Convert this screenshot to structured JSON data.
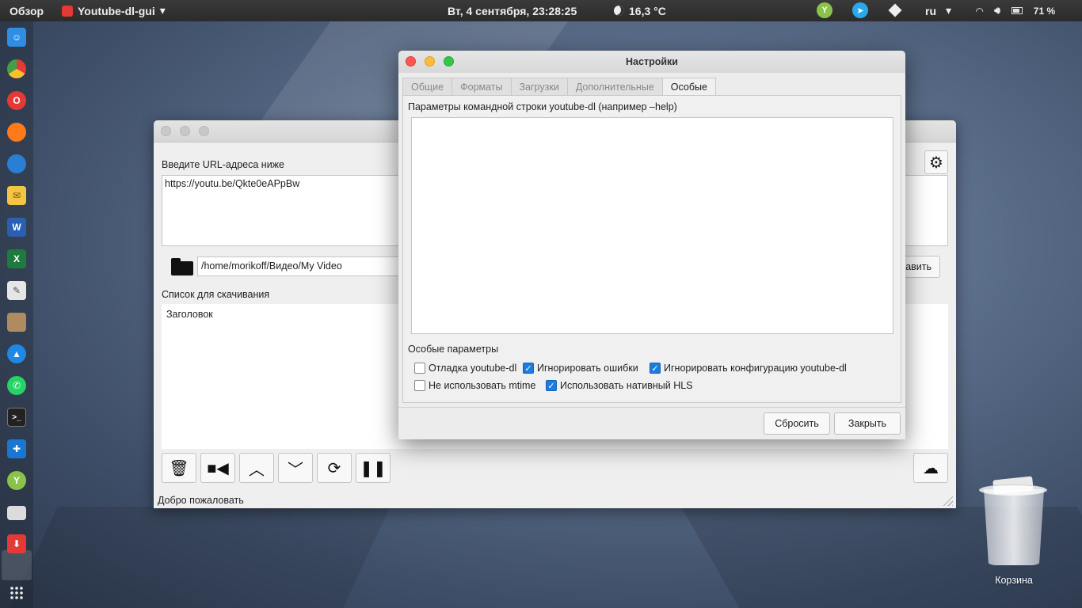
{
  "topbar": {
    "overview": "Обзор",
    "app_name": "Youtube-dl-gui",
    "app_menu_arrow": "▾",
    "clock": "Вт, 4 сентября, 23:28:25",
    "weather": "16,3 °C",
    "lang": "ru",
    "lang_arrow": "▾",
    "battery": "71 %"
  },
  "dock": {
    "icons": [
      "finder-icon",
      "chrome-icon",
      "opera-icon",
      "firefox-icon",
      "thunderbird-icon",
      "mail-icon",
      "word-icon",
      "excel-icon",
      "notes-icon",
      "archive-icon",
      "browser-icon",
      "whatsapp-icon",
      "terminal-icon",
      "app-store-icon",
      "yandex-icon",
      "disk-icon",
      "youtube-dl-gui-icon",
      "app-grid-icon"
    ]
  },
  "main_window": {
    "url_label": "Введите URL-адреса ниже",
    "url_value": "https://youtu.be/Qkte0eAPpBw",
    "path_value": "/home/morikoff/Видео/My Video",
    "add_button_label": "авить",
    "list_label": "Список для скачивания",
    "list_header": "Заголовок",
    "status": "Добро пожаловать"
  },
  "dialog": {
    "title": "Настройки",
    "tabs": [
      {
        "label": "Общие",
        "active": false
      },
      {
        "label": "Форматы",
        "active": false
      },
      {
        "label": "Загрузки",
        "active": false
      },
      {
        "label": "Дополнительные",
        "active": false
      },
      {
        "label": "Особые",
        "active": true
      }
    ],
    "cmd_label": "Параметры командной строки youtube-dl (например –help)",
    "cmd_value": "",
    "special_label": "Особые параметры",
    "options": [
      {
        "label": "Отладка youtube-dl",
        "checked": false
      },
      {
        "label": "Игнорировать ошибки",
        "checked": true
      },
      {
        "label": "Игнорировать конфигурацию youtube-dl",
        "checked": true
      },
      {
        "label": "Не использовать mtime",
        "checked": false
      },
      {
        "label": "Использовать нативный HLS",
        "checked": true
      }
    ],
    "reset_label": "Сбросить",
    "close_label": "Закрыть"
  },
  "desktop": {
    "trash_label": "Корзина"
  },
  "colors": {
    "accent": "#1e7be0",
    "close_light": "#fc5753",
    "minimize_light": "#fdbc40",
    "zoom_light": "#33c748"
  }
}
